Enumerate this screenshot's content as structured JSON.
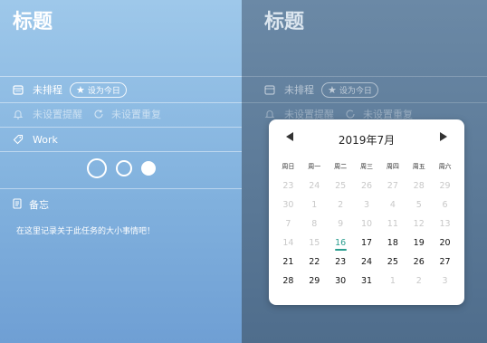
{
  "left": {
    "title": "标题",
    "schedule_label": "未排程",
    "set_today_label": "设为今日",
    "reminder_label": "未设置提醒",
    "repeat_label": "未设置重复",
    "tag_label": "Work",
    "memo_title": "备忘",
    "memo_text": "在这里记录关于此任务的大小事情吧！"
  },
  "right": {
    "title": "标题",
    "schedule_label": "未排程",
    "set_today_label": "设为今日",
    "reminder_label": "未设置提醒",
    "repeat_label": "未设置重复"
  },
  "calendar": {
    "month_label": "2019年7月",
    "weekdays": [
      "周日",
      "周一",
      "周二",
      "周三",
      "周四",
      "周五",
      "周六"
    ],
    "weeks": [
      [
        {
          "d": "23",
          "s": "dim"
        },
        {
          "d": "24",
          "s": "dim"
        },
        {
          "d": "25",
          "s": "dim"
        },
        {
          "d": "26",
          "s": "dim"
        },
        {
          "d": "27",
          "s": "dim"
        },
        {
          "d": "28",
          "s": "dim"
        },
        {
          "d": "29",
          "s": "dim"
        }
      ],
      [
        {
          "d": "30",
          "s": "dim"
        },
        {
          "d": "1",
          "s": "dim"
        },
        {
          "d": "2",
          "s": "dim"
        },
        {
          "d": "3",
          "s": "dim"
        },
        {
          "d": "4",
          "s": "dim"
        },
        {
          "d": "5",
          "s": "dim"
        },
        {
          "d": "6",
          "s": "dim"
        }
      ],
      [
        {
          "d": "7",
          "s": "dim"
        },
        {
          "d": "8",
          "s": "dim"
        },
        {
          "d": "9",
          "s": "dim"
        },
        {
          "d": "10",
          "s": "dim"
        },
        {
          "d": "11",
          "s": "dim"
        },
        {
          "d": "12",
          "s": "dim"
        },
        {
          "d": "13",
          "s": "dim"
        }
      ],
      [
        {
          "d": "14",
          "s": "dim"
        },
        {
          "d": "15",
          "s": "dim"
        },
        {
          "d": "16",
          "s": "today"
        },
        {
          "d": "17",
          "s": "on"
        },
        {
          "d": "18",
          "s": "on"
        },
        {
          "d": "19",
          "s": "on"
        },
        {
          "d": "20",
          "s": "on"
        }
      ],
      [
        {
          "d": "21",
          "s": "on"
        },
        {
          "d": "22",
          "s": "on"
        },
        {
          "d": "23",
          "s": "on"
        },
        {
          "d": "24",
          "s": "on"
        },
        {
          "d": "25",
          "s": "on"
        },
        {
          "d": "26",
          "s": "on"
        },
        {
          "d": "27",
          "s": "on"
        }
      ],
      [
        {
          "d": "28",
          "s": "on"
        },
        {
          "d": "29",
          "s": "on"
        },
        {
          "d": "30",
          "s": "on"
        },
        {
          "d": "31",
          "s": "on"
        },
        {
          "d": "1",
          "s": "dim"
        },
        {
          "d": "2",
          "s": "dim"
        },
        {
          "d": "3",
          "s": "dim"
        }
      ]
    ]
  },
  "colors": {
    "accent": "#2a9d8f",
    "left_bg": "#8cbbe4",
    "right_bg": "#5f7d9b"
  }
}
